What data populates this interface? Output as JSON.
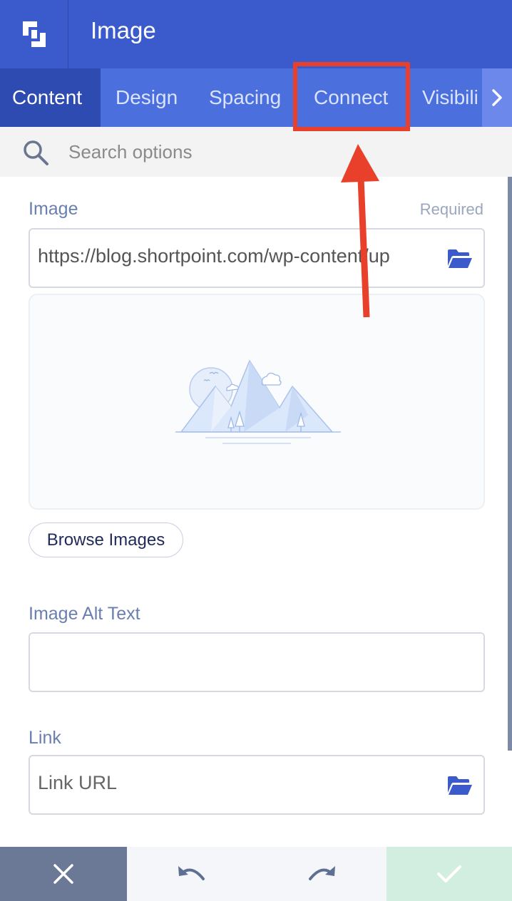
{
  "header": {
    "title": "Image",
    "logo_icon": "shortpoint-logo-icon"
  },
  "tabs": [
    {
      "label": "Content",
      "active": true
    },
    {
      "label": "Design",
      "active": false
    },
    {
      "label": "Spacing",
      "active": false
    },
    {
      "label": "Connect",
      "active": false
    },
    {
      "label": "Visibili",
      "active": false
    }
  ],
  "tabs_next_icon": "chevron-right-icon",
  "search": {
    "placeholder": "Search options",
    "icon": "search-icon"
  },
  "image_field": {
    "label": "Image",
    "required_label": "Required",
    "value": "https://blog.shortpoint.com/wp-content/up",
    "folder_icon": "folder-open-icon",
    "browse_label": "Browse Images"
  },
  "alt_field": {
    "label": "Image Alt Text",
    "value": ""
  },
  "link_field": {
    "label": "Link",
    "placeholder": "Link URL",
    "folder_icon": "folder-open-icon"
  },
  "footer": {
    "close_icon": "close-icon",
    "undo_icon": "undo-icon",
    "redo_icon": "redo-icon",
    "confirm_icon": "check-icon"
  },
  "colors": {
    "header": "#3b5bcc",
    "tabs": "#4b6fdc",
    "active_tab": "#2d4bb1",
    "annotation": "#e8402a",
    "accent_icon": "#3b5bcc"
  }
}
